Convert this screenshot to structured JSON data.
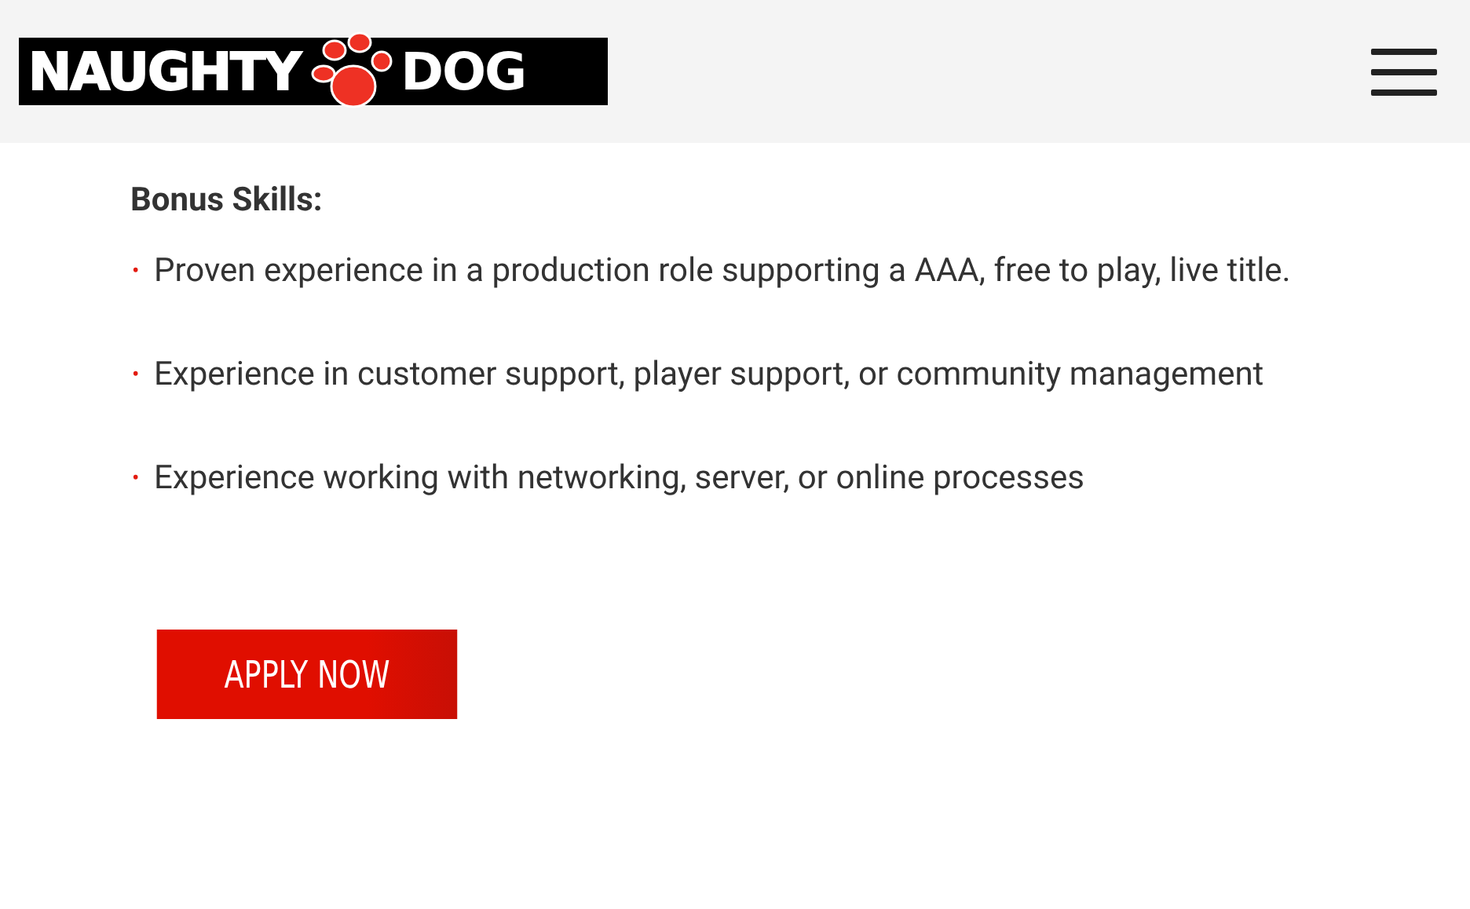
{
  "header": {
    "logo": {
      "left": "NAUGHTY",
      "right": "DOG"
    }
  },
  "section": {
    "heading": "Bonus Skills:",
    "items": [
      {
        "bullet": "•",
        "text": "Proven experience in a production role supporting a AAA, free to play, live title."
      },
      {
        "bullet": "•",
        "text": "Experience in customer support, player support, or community management"
      },
      {
        "bullet": "•",
        "text": "Experience working with networking, server, or online processes"
      }
    ]
  },
  "apply_button": "APPLY NOW"
}
